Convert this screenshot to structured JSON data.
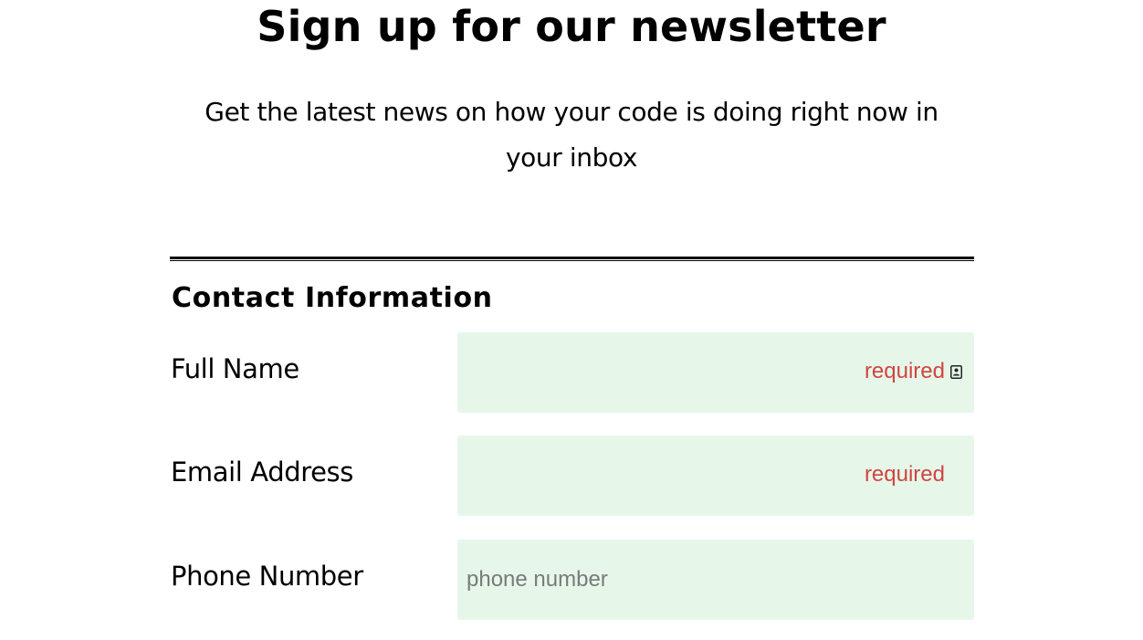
{
  "header": {
    "title": "Sign up for our newsletter",
    "subtitle": "Get the latest news on how your code is doing right now in your inbox"
  },
  "form": {
    "legend": "Contact Information",
    "fields": [
      {
        "label": "Full Name",
        "value": "",
        "placeholder": "",
        "required_text": "required",
        "icon": "contact-card-icon"
      },
      {
        "label": "Email Address",
        "value": "",
        "placeholder": "",
        "required_text": "required"
      },
      {
        "label": "Phone Number",
        "value": "",
        "placeholder": "phone number"
      }
    ]
  },
  "colors": {
    "field_background": "#e6f7ea",
    "required_text": "#d0453f",
    "text": "#000000",
    "placeholder": "#7a7a7a"
  }
}
